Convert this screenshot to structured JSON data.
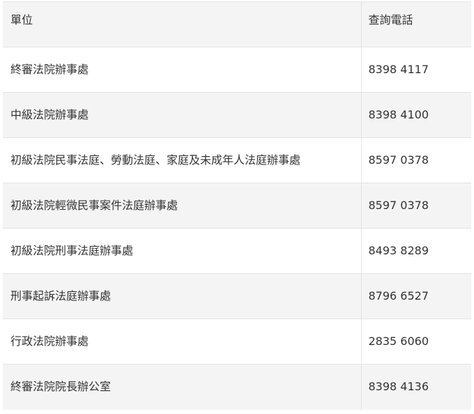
{
  "table": {
    "headers": [
      "單位",
      "查詢電話"
    ],
    "rows": [
      {
        "unit": "終審法院辦事處",
        "phone": "8398 4117"
      },
      {
        "unit": "中級法院辦事處",
        "phone": "8398 4100"
      },
      {
        "unit": "初級法院民事法庭、勞動法庭、家庭及未成年人法庭辦事處",
        "phone": "8597 0378"
      },
      {
        "unit": "初級法院輕微民事案件法庭辦事處",
        "phone": "8597 0378"
      },
      {
        "unit": "初級法院刑事法庭辦事處",
        "phone": "8493 8289"
      },
      {
        "unit": "刑事起訴法庭辦事處",
        "phone": "8796 6527"
      },
      {
        "unit": "行政法院辦事處",
        "phone": "2835 6060"
      },
      {
        "unit": "終審法院院長辦公室",
        "phone": "8398 4136"
      }
    ]
  },
  "colors": {
    "stripe": "#f4f4f4",
    "border": "#e3e3e3",
    "text": "#333333"
  }
}
